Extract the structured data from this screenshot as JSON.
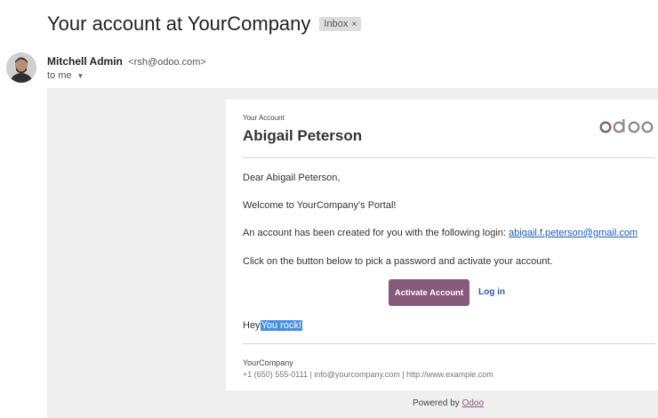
{
  "email": {
    "subject": "Your account at YourCompany",
    "label": "Inbox",
    "sender_name": "Mitchell Admin",
    "sender_email": "<rsh@odoo.com>",
    "to_text": "to me"
  },
  "card": {
    "kicker": "Your Account",
    "recipient_name": "Abigail Peterson",
    "logo_text": "odoo",
    "greeting": "Dear Abigail Peterson,",
    "welcome": "Welcome to YourCompany's Portal!",
    "login_prefix": "An account has been created for you with the following login: ",
    "login_email": "abigail.f.peterson@gmail.com",
    "instruction": "Click on the button below to pick a password and activate your account.",
    "activate_label": "Activate Account",
    "login_label": "Log in",
    "hey_prefix": "Hey",
    "hey_selected": "You rock!",
    "company": "YourCompany",
    "contact": "+1 (650) 555-0111 | info@yourcompany.com | http://www.example.com"
  },
  "footer": {
    "powered_prefix": "Powered by ",
    "powered_link": "Odoo"
  },
  "colors": {
    "brand": "#875a7b",
    "link": "#1a5fb4",
    "selection": "#4a90e2"
  }
}
